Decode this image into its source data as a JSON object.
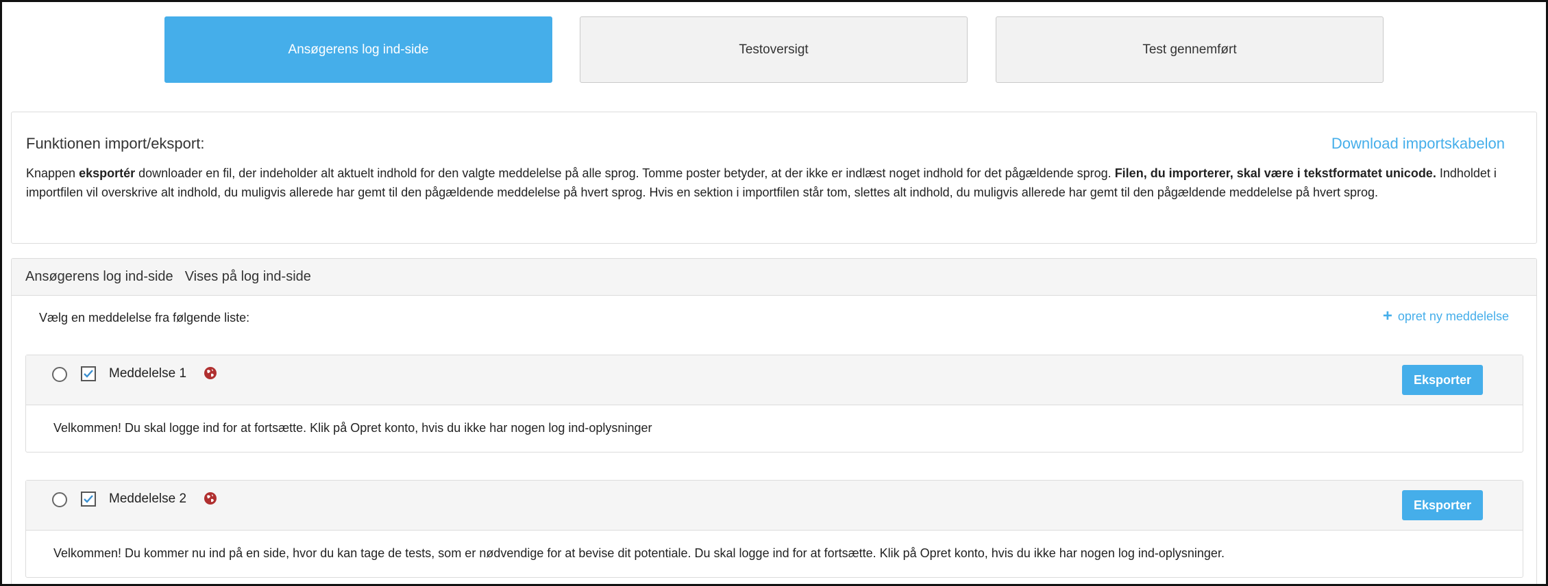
{
  "tabs": [
    {
      "label": "Ansøgerens log ind-side",
      "active": true
    },
    {
      "label": "Testoversigt",
      "active": false
    },
    {
      "label": "Test gennemført",
      "active": false
    }
  ],
  "info": {
    "title": "Funktionen import/eksport:",
    "download_link": "Download importskabelon",
    "text_1": "Knappen ",
    "text_bold_1": "eksportér",
    "text_2": " downloader en fil, der indeholder alt aktuelt indhold for den valgte meddelelse på alle sprog. Tomme poster betyder, at der ikke er indlæst noget indhold for det pågældende sprog. ",
    "text_bold_2": "Filen, du importerer, skal være i tekstformatet unicode.",
    "text_3": " Indholdet i importfilen vil overskrive alt indhold, du muligvis allerede har gemt til den pågældende meddelelse på hvert sprog. Hvis en sektion i importfilen står tom, slettes alt indhold, du muligvis allerede har gemt til den pågældende meddelelse på hvert sprog."
  },
  "messages_panel": {
    "header_title": "Ansøgerens log ind-side",
    "header_subtitle": "Vises på log ind-side",
    "choose_label": "Vælg en meddelelse fra følgende liste:",
    "new_message_label": "opret ny meddelelse",
    "export_label": "Eksporter",
    "items": [
      {
        "label": "Meddelelse 1",
        "checked": true,
        "text": "Velkommen! Du skal logge ind for at fortsætte. Klik på Opret konto, hvis du ikke har nogen log ind-oplysninger"
      },
      {
        "label": "Meddelelse 2",
        "checked": true,
        "text": "Velkommen! Du kommer nu ind på en side, hvor du kan tage de tests, som er nødvendige for at bevise dit potentiale. Du skal logge ind for at fortsætte. Klik på Opret konto, hvis du ikke har nogen log ind-oplysninger."
      }
    ]
  },
  "icons": {
    "plus": "plus-icon",
    "globe": "globe-icon",
    "check": "check-icon"
  },
  "colors": {
    "accent": "#45aeea",
    "globe": "#b03030"
  }
}
